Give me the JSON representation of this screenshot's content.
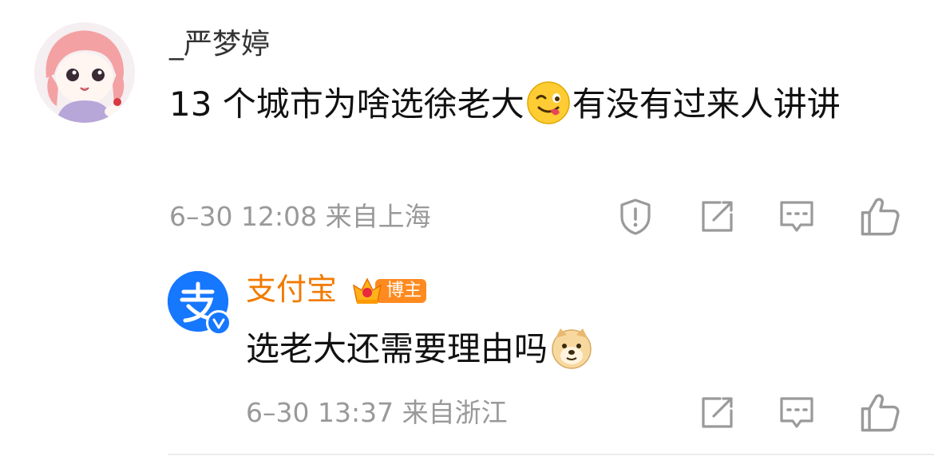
{
  "comment": {
    "username": "_严梦婷",
    "text_part1": "13 个城市为啥选徐老大",
    "text_part2": "有没有过来人讲讲",
    "meta": "6–30 12:08 来自上海"
  },
  "reply": {
    "username": "支付宝",
    "badge": "博主",
    "text": "选老大还需要理由吗",
    "meta": "6–30 13:37 来自浙江"
  },
  "colors": {
    "accent": "#f27a00",
    "meta_gray": "#999999",
    "alipay_blue": "#1677ff"
  },
  "icons": {
    "report": "report-icon",
    "share": "share-icon",
    "reply": "comment-icon",
    "like": "like-icon"
  }
}
